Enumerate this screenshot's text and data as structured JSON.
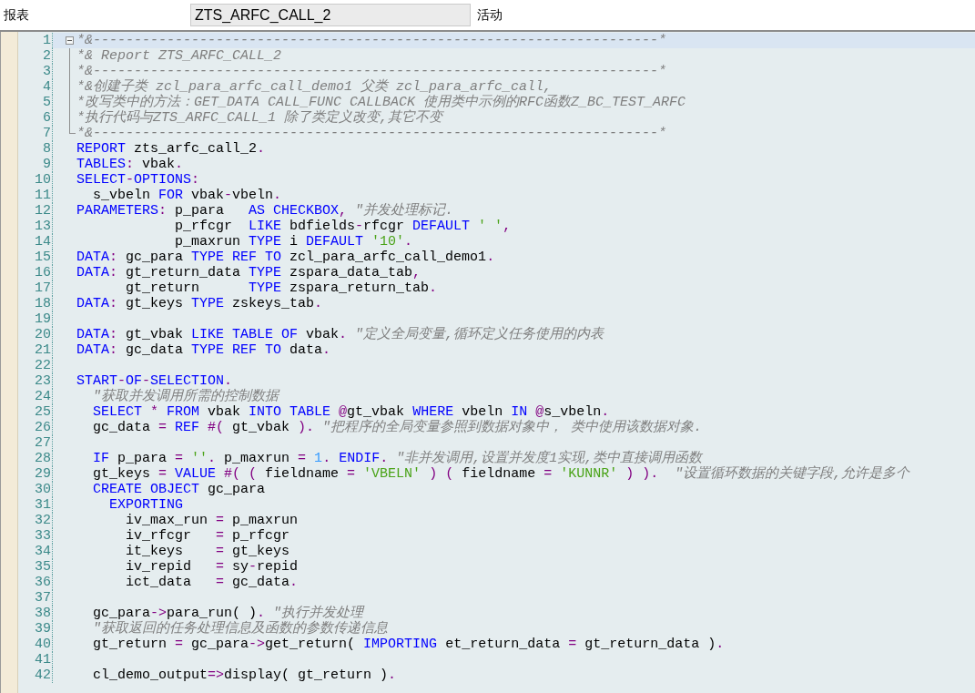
{
  "header": {
    "label": "报表",
    "program_name": "ZTS_ARFC_CALL_2",
    "status": "活动"
  },
  "editor": {
    "lines": [
      {
        "number": "1",
        "selected": true,
        "expanded": true,
        "tokens": [
          {
            "kind": "comment",
            "text": "*&---------------------------------------------------------------------*"
          }
        ],
        "children": [
          {
            "number": "2",
            "selected": false,
            "tokens": [
              {
                "kind": "comment",
                "text": "*& Report ZTS_ARFC_CALL_2"
              }
            ]
          },
          {
            "number": "3",
            "selected": false,
            "tokens": [
              {
                "kind": "comment",
                "text": "*&---------------------------------------------------------------------*"
              }
            ]
          },
          {
            "number": "4",
            "selected": false,
            "tokens": [
              {
                "kind": "comment",
                "text": "*&创建子类 zcl_para_arfc_call_demo1 父类 zcl_para_arfc_call,"
              }
            ]
          },
          {
            "number": "5",
            "selected": false,
            "tokens": [
              {
                "kind": "comment",
                "text": "*改写类中的方法：GET_DATA CALL_FUNC CALLBACK 使用类中示例的RFC函数Z_BC_TEST_ARFC"
              }
            ]
          },
          {
            "number": "6",
            "selected": false,
            "tokens": [
              {
                "kind": "comment",
                "text": "*执行代码与ZTS_ARFC_CALL_1 除了类定义改变,其它不变"
              }
            ]
          },
          {
            "number": "7",
            "selected": false,
            "tokens": [
              {
                "kind": "comment",
                "text": "*&---------------------------------------------------------------------*"
              }
            ]
          }
        ]
      },
      {
        "number": "8",
        "selected": false,
        "tokens": [
          {
            "kind": "keyword",
            "text": "REPORT"
          },
          {
            "kind": "text",
            "text": " zts_arfc_call_2"
          },
          {
            "kind": "operator",
            "text": "."
          }
        ]
      },
      {
        "number": "9",
        "selected": false,
        "tokens": [
          {
            "kind": "keyword",
            "text": "TABLES"
          },
          {
            "kind": "operator",
            "text": ":"
          },
          {
            "kind": "text",
            "text": " vbak"
          },
          {
            "kind": "operator",
            "text": "."
          }
        ]
      },
      {
        "number": "10",
        "selected": false,
        "tokens": [
          {
            "kind": "keyword",
            "text": "SELECT"
          },
          {
            "kind": "operator",
            "text": "-"
          },
          {
            "kind": "keyword",
            "text": "OPTIONS"
          },
          {
            "kind": "operator",
            "text": ":"
          }
        ]
      },
      {
        "number": "11",
        "selected": false,
        "tokens": [
          {
            "kind": "text",
            "text": "  s_vbeln "
          },
          {
            "kind": "keyword",
            "text": "FOR"
          },
          {
            "kind": "text",
            "text": " vbak"
          },
          {
            "kind": "operator",
            "text": "-"
          },
          {
            "kind": "text",
            "text": "vbeln"
          },
          {
            "kind": "operator",
            "text": "."
          }
        ]
      },
      {
        "number": "12",
        "selected": false,
        "tokens": [
          {
            "kind": "keyword",
            "text": "PARAMETERS"
          },
          {
            "kind": "operator",
            "text": ":"
          },
          {
            "kind": "text",
            "text": " p_para   "
          },
          {
            "kind": "keyword",
            "text": "AS CHECKBOX"
          },
          {
            "kind": "operator",
            "text": ", "
          },
          {
            "kind": "comment",
            "text": "\"并发处理标记."
          }
        ]
      },
      {
        "number": "13",
        "selected": false,
        "tokens": [
          {
            "kind": "text",
            "text": "            p_rfcgr  "
          },
          {
            "kind": "keyword",
            "text": "LIKE"
          },
          {
            "kind": "text",
            "text": " bdfields"
          },
          {
            "kind": "operator",
            "text": "-"
          },
          {
            "kind": "text",
            "text": "rfcgr "
          },
          {
            "kind": "keyword",
            "text": "DEFAULT "
          },
          {
            "kind": "string",
            "text": "' '"
          },
          {
            "kind": "operator",
            "text": ","
          }
        ]
      },
      {
        "number": "14",
        "selected": false,
        "tokens": [
          {
            "kind": "text",
            "text": "            p_maxrun "
          },
          {
            "kind": "keyword",
            "text": "TYPE"
          },
          {
            "kind": "text",
            "text": " i "
          },
          {
            "kind": "keyword",
            "text": "DEFAULT "
          },
          {
            "kind": "string",
            "text": "'10'"
          },
          {
            "kind": "operator",
            "text": "."
          }
        ]
      },
      {
        "number": "15",
        "selected": false,
        "tokens": [
          {
            "kind": "keyword",
            "text": "DATA"
          },
          {
            "kind": "operator",
            "text": ":"
          },
          {
            "kind": "text",
            "text": " gc_para "
          },
          {
            "kind": "keyword",
            "text": "TYPE REF TO"
          },
          {
            "kind": "text",
            "text": " zcl_para_arfc_call_demo1"
          },
          {
            "kind": "operator",
            "text": "."
          }
        ]
      },
      {
        "number": "16",
        "selected": false,
        "tokens": [
          {
            "kind": "keyword",
            "text": "DATA"
          },
          {
            "kind": "operator",
            "text": ":"
          },
          {
            "kind": "text",
            "text": " gt_return_data "
          },
          {
            "kind": "keyword",
            "text": "TYPE"
          },
          {
            "kind": "text",
            "text": " zspara_data_tab"
          },
          {
            "kind": "operator",
            "text": ","
          }
        ]
      },
      {
        "number": "17",
        "selected": false,
        "tokens": [
          {
            "kind": "text",
            "text": "      gt_return      "
          },
          {
            "kind": "keyword",
            "text": "TYPE"
          },
          {
            "kind": "text",
            "text": " zspara_return_tab"
          },
          {
            "kind": "operator",
            "text": "."
          }
        ]
      },
      {
        "number": "18",
        "selected": false,
        "tokens": [
          {
            "kind": "keyword",
            "text": "DATA"
          },
          {
            "kind": "operator",
            "text": ":"
          },
          {
            "kind": "text",
            "text": " gt_keys "
          },
          {
            "kind": "keyword",
            "text": "TYPE"
          },
          {
            "kind": "text",
            "text": " zskeys_tab"
          },
          {
            "kind": "operator",
            "text": "."
          }
        ]
      },
      {
        "number": "19",
        "selected": false
      },
      {
        "number": "20",
        "selected": false,
        "tokens": [
          {
            "kind": "keyword",
            "text": "DATA"
          },
          {
            "kind": "operator",
            "text": ":"
          },
          {
            "kind": "text",
            "text": " gt_vbak "
          },
          {
            "kind": "keyword",
            "text": "LIKE TABLE OF"
          },
          {
            "kind": "text",
            "text": " vbak"
          },
          {
            "kind": "operator",
            "text": ". "
          },
          {
            "kind": "comment",
            "text": "\"定义全局变量,循环定义任务使用的内表"
          }
        ]
      },
      {
        "number": "21",
        "selected": false,
        "tokens": [
          {
            "kind": "keyword",
            "text": "DATA"
          },
          {
            "kind": "operator",
            "text": ":"
          },
          {
            "kind": "text",
            "text": " gc_data "
          },
          {
            "kind": "keyword",
            "text": "TYPE REF TO"
          },
          {
            "kind": "text",
            "text": " data"
          },
          {
            "kind": "operator",
            "text": "."
          }
        ]
      },
      {
        "number": "22",
        "selected": false
      },
      {
        "number": "23",
        "selected": false,
        "tokens": [
          {
            "kind": "keyword",
            "text": "START"
          },
          {
            "kind": "operator",
            "text": "-"
          },
          {
            "kind": "keyword",
            "text": "OF"
          },
          {
            "kind": "operator",
            "text": "-"
          },
          {
            "kind": "keyword",
            "text": "SELECTION"
          },
          {
            "kind": "operator",
            "text": "."
          }
        ]
      },
      {
        "number": "24",
        "selected": false,
        "tokens": [
          {
            "kind": "comment",
            "text": "  \"获取并发调用所需的控制数据"
          }
        ]
      },
      {
        "number": "25",
        "selected": false,
        "tokens": [
          {
            "kind": "keyword",
            "text": "  SELECT "
          },
          {
            "kind": "operator",
            "text": "* "
          },
          {
            "kind": "keyword",
            "text": "FROM"
          },
          {
            "kind": "text",
            "text": " vbak "
          },
          {
            "kind": "keyword",
            "text": "INTO TABLE "
          },
          {
            "kind": "operator",
            "text": "@"
          },
          {
            "kind": "text",
            "text": "gt_vbak "
          },
          {
            "kind": "keyword",
            "text": "WHERE"
          },
          {
            "kind": "text",
            "text": " vbeln "
          },
          {
            "kind": "keyword",
            "text": "IN "
          },
          {
            "kind": "operator",
            "text": "@"
          },
          {
            "kind": "text",
            "text": "s_vbeln"
          },
          {
            "kind": "operator",
            "text": "."
          }
        ]
      },
      {
        "number": "26",
        "selected": false,
        "tokens": [
          {
            "kind": "text",
            "text": "  gc_data "
          },
          {
            "kind": "operator",
            "text": "= "
          },
          {
            "kind": "keyword",
            "text": "REF "
          },
          {
            "kind": "operator",
            "text": "#("
          },
          {
            "kind": "text",
            "text": " gt_vbak "
          },
          {
            "kind": "operator",
            "text": "). "
          },
          {
            "kind": "comment",
            "text": "\"把程序的全局变量参照到数据对象中， 类中使用该数据对象."
          }
        ]
      },
      {
        "number": "27",
        "selected": false
      },
      {
        "number": "28",
        "selected": false,
        "tokens": [
          {
            "kind": "keyword",
            "text": "  IF"
          },
          {
            "kind": "text",
            "text": " p_para "
          },
          {
            "kind": "operator",
            "text": "= "
          },
          {
            "kind": "string",
            "text": "''"
          },
          {
            "kind": "operator",
            "text": "."
          },
          {
            "kind": "text",
            "text": " p_maxrun "
          },
          {
            "kind": "operator",
            "text": "= "
          },
          {
            "kind": "number",
            "text": "1"
          },
          {
            "kind": "operator",
            "text": ". "
          },
          {
            "kind": "keyword",
            "text": "ENDIF"
          },
          {
            "kind": "operator",
            "text": ". "
          },
          {
            "kind": "comment",
            "text": "\"非并发调用,设置并发度1实现,类中直接调用函数"
          }
        ]
      },
      {
        "number": "29",
        "selected": false,
        "tokens": [
          {
            "kind": "text",
            "text": "  gt_keys "
          },
          {
            "kind": "operator",
            "text": "= "
          },
          {
            "kind": "keyword",
            "text": "VALUE "
          },
          {
            "kind": "operator",
            "text": "#( ("
          },
          {
            "kind": "text",
            "text": " fieldname "
          },
          {
            "kind": "operator",
            "text": "= "
          },
          {
            "kind": "string",
            "text": "'VBELN'"
          },
          {
            "kind": "operator",
            "text": " ) ("
          },
          {
            "kind": "text",
            "text": " fieldname "
          },
          {
            "kind": "operator",
            "text": "= "
          },
          {
            "kind": "string",
            "text": "'KUNNR'"
          },
          {
            "kind": "operator",
            "text": " ) ).  "
          },
          {
            "kind": "comment",
            "text": "\"设置循环数据的关键字段,允许是多个"
          }
        ]
      },
      {
        "number": "30",
        "selected": false,
        "tokens": [
          {
            "kind": "keyword",
            "text": "  CREATE OBJECT"
          },
          {
            "kind": "text",
            "text": " gc_para"
          }
        ]
      },
      {
        "number": "31",
        "selected": false,
        "tokens": [
          {
            "kind": "keyword",
            "text": "    EXPORTING"
          }
        ]
      },
      {
        "number": "32",
        "selected": false,
        "tokens": [
          {
            "kind": "text",
            "text": "      iv_max_run "
          },
          {
            "kind": "operator",
            "text": "="
          },
          {
            "kind": "text",
            "text": " p_maxrun"
          }
        ]
      },
      {
        "number": "33",
        "selected": false,
        "tokens": [
          {
            "kind": "text",
            "text": "      iv_rfcgr   "
          },
          {
            "kind": "operator",
            "text": "="
          },
          {
            "kind": "text",
            "text": " p_rfcgr"
          }
        ]
      },
      {
        "number": "34",
        "selected": false,
        "tokens": [
          {
            "kind": "text",
            "text": "      it_keys    "
          },
          {
            "kind": "operator",
            "text": "="
          },
          {
            "kind": "text",
            "text": " gt_keys"
          }
        ]
      },
      {
        "number": "35",
        "selected": false,
        "tokens": [
          {
            "kind": "text",
            "text": "      iv_repid   "
          },
          {
            "kind": "operator",
            "text": "="
          },
          {
            "kind": "text",
            "text": " sy"
          },
          {
            "kind": "operator",
            "text": "-"
          },
          {
            "kind": "text",
            "text": "repid"
          }
        ]
      },
      {
        "number": "36",
        "selected": false,
        "tokens": [
          {
            "kind": "text",
            "text": "      ict_data   "
          },
          {
            "kind": "operator",
            "text": "="
          },
          {
            "kind": "text",
            "text": " gc_data"
          },
          {
            "kind": "operator",
            "text": "."
          }
        ]
      },
      {
        "number": "37",
        "selected": false
      },
      {
        "number": "38",
        "selected": false,
        "tokens": [
          {
            "kind": "text",
            "text": "  gc_para"
          },
          {
            "kind": "operator",
            "text": "->"
          },
          {
            "kind": "text",
            "text": "para_run( )"
          },
          {
            "kind": "operator",
            "text": ". "
          },
          {
            "kind": "comment",
            "text": "\"执行并发处理"
          }
        ]
      },
      {
        "number": "39",
        "selected": false,
        "tokens": [
          {
            "kind": "comment",
            "text": "  \"获取返回的任务处理信息及函数的参数传递信息"
          }
        ]
      },
      {
        "number": "40",
        "selected": false,
        "tokens": [
          {
            "kind": "text",
            "text": "  gt_return "
          },
          {
            "kind": "operator",
            "text": "="
          },
          {
            "kind": "text",
            "text": " gc_para"
          },
          {
            "kind": "operator",
            "text": "->"
          },
          {
            "kind": "text",
            "text": "get_return( "
          },
          {
            "kind": "keyword",
            "text": "IMPORTING"
          },
          {
            "kind": "text",
            "text": " et_return_data "
          },
          {
            "kind": "operator",
            "text": "="
          },
          {
            "kind": "text",
            "text": " gt_return_data )"
          },
          {
            "kind": "operator",
            "text": "."
          }
        ]
      },
      {
        "number": "41",
        "selected": false
      },
      {
        "number": "42",
        "selected": false,
        "tokens": [
          {
            "kind": "text",
            "text": "  cl_demo_output"
          },
          {
            "kind": "operator",
            "text": "=>"
          },
          {
            "kind": "text",
            "text": "display( gt_return )"
          },
          {
            "kind": "operator",
            "text": "."
          }
        ]
      }
    ]
  }
}
